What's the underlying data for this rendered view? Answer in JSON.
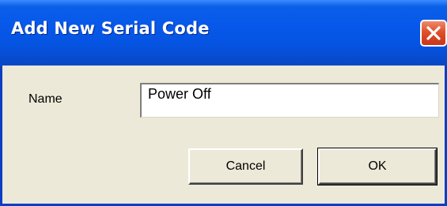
{
  "window": {
    "title": "Add New Serial Code",
    "close_icon": "close-icon"
  },
  "form": {
    "name_label": "Name",
    "name_value": "Power Off"
  },
  "buttons": {
    "cancel_label": "Cancel",
    "ok_label": "OK"
  },
  "colors": {
    "titlebar": "#0553e0",
    "dialog_bg": "#ece9d8",
    "close_button": "#e0502a"
  }
}
